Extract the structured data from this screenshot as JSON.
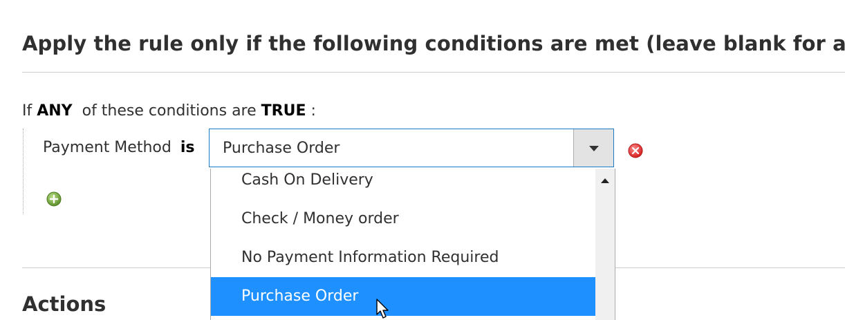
{
  "section": {
    "title": "Apply the rule only if the following conditions are met (leave blank for all products)."
  },
  "conditions": {
    "prefix": "If",
    "aggregator": "ANY",
    "middle": "of these conditions are",
    "value": "TRUE",
    "suffix": ":",
    "row": {
      "attribute": "Payment Method",
      "operator": "is",
      "selected": "Purchase Order"
    },
    "remove_icon": "remove-circle-icon",
    "add_icon": "add-circle-icon"
  },
  "dropdown": {
    "options": [
      "Cash On Delivery",
      "Check / Money order",
      "No Payment Information Required",
      "Purchase Order"
    ],
    "highlighted": "Purchase Order"
  },
  "actions": {
    "title": "Actions"
  },
  "colors": {
    "accent": "#1979c3",
    "highlight": "#1e90ff",
    "remove": "#e02b27",
    "add": "#79a22e"
  }
}
